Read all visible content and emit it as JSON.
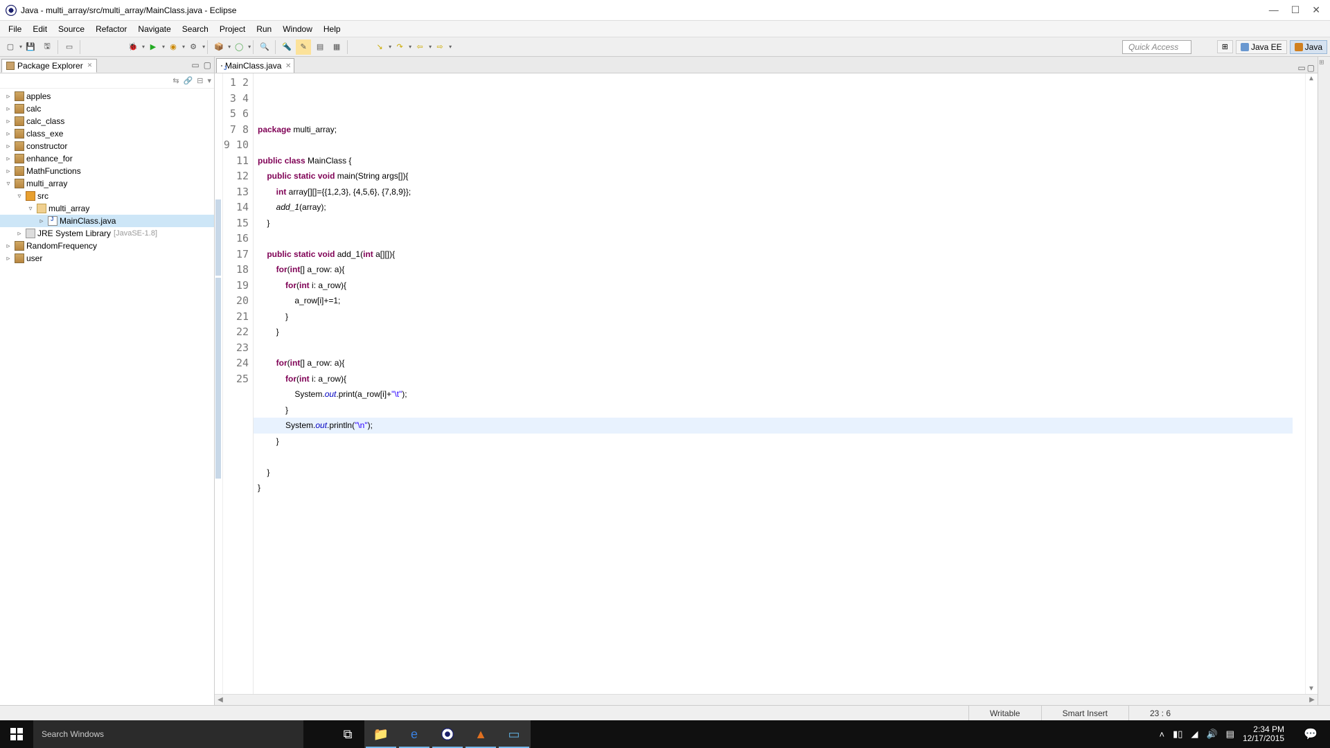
{
  "window": {
    "title": "Java - multi_array/src/multi_array/MainClass.java - Eclipse"
  },
  "menu": [
    "File",
    "Edit",
    "Source",
    "Refactor",
    "Navigate",
    "Search",
    "Project",
    "Run",
    "Window",
    "Help"
  ],
  "quick_access": "Quick Access",
  "perspectives": {
    "javaee": "Java EE",
    "java": "Java"
  },
  "package_explorer": {
    "title": "Package Explorer",
    "projects": [
      "apples",
      "calc",
      "calc_class",
      "class_exe",
      "constructor",
      "enhance_for",
      "MathFunctions"
    ],
    "open_project": "multi_array",
    "src": "src",
    "pkg": "multi_array",
    "file": "MainClass.java",
    "jre": "JRE System Library",
    "jre_suffix": "[JavaSE-1.8]",
    "projects_after": [
      "RandomFrequency",
      "user"
    ]
  },
  "editor": {
    "tab": "MainClass.java",
    "code_html": "<span class='kw'>package</span> multi_array;\n\n<span class='kw'>public</span> <span class='kw'>class</span> MainClass {\n    <span class='kw'>public</span> <span class='kw'>static</span> <span class='kw'>void</span> main(String args[]){\n        <span class='kw'>int</span> array[][]={{1,2,3}, {4,5,6}, {7,8,9}};\n        <span class='mi'>add_1</span>(array);\n    }\n\n    <span class='kw'>public</span> <span class='kw'>static</span> <span class='kw'>void</span> add_1(<span class='kw'>int</span> a[][]){\n        <span class='kw'>for</span>(<span class='kw'>int</span>[] a_row: a){\n            <span class='kw'>for</span>(<span class='kw'>int</span> i: a_row){\n                a_row[i]+=1;\n            }\n        }\n\n        <span class='kw'>for</span>(<span class='kw'>int</span>[] a_row: a){\n            <span class='kw'>for</span>(<span class='kw'>int</span> i: a_row){\n                System.<span class='fi'>out</span>.print(a_row[i]+<span class='str'>\"\\t\"</span>);\n            }\n            System.<span class='fi'>out</span>.println(<span class='str'>\"\\n\"</span>);\n        }\n\n    }\n}\n",
    "line_count": 25
  },
  "status": {
    "writable": "Writable",
    "insert": "Smart Insert",
    "pos": "23 : 6"
  },
  "taskbar": {
    "search_placeholder": "Search Windows",
    "time": "2:34 PM",
    "date": "12/17/2015"
  }
}
